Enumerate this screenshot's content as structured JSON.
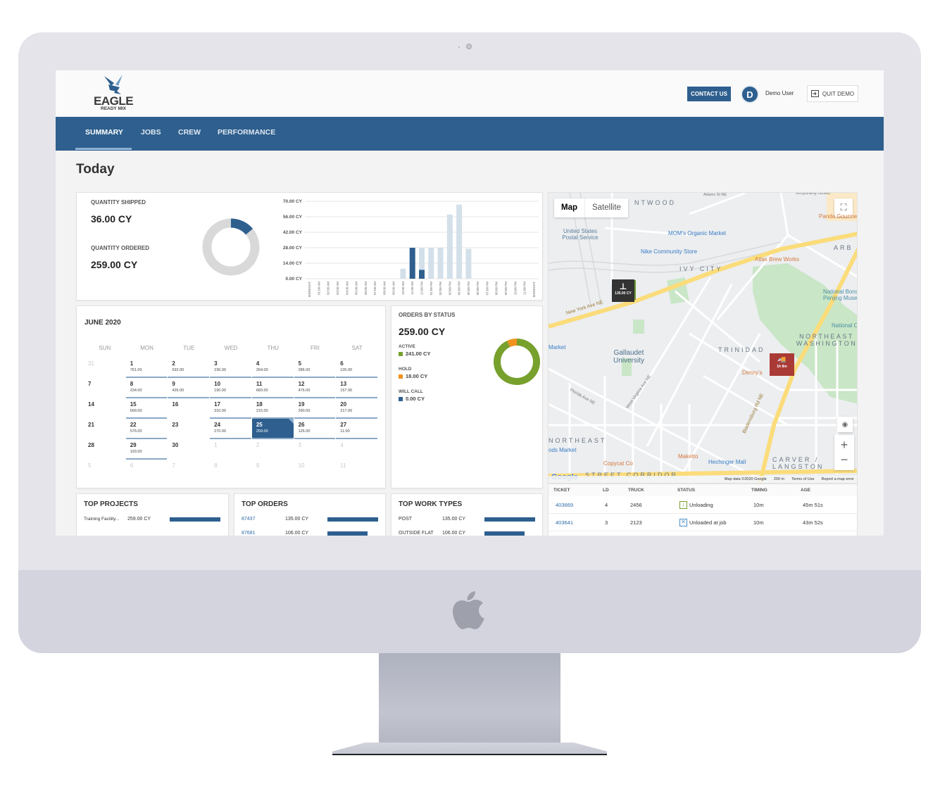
{
  "app": {
    "brand": "EAGLE",
    "brand_sub": "READY MIX",
    "contact_label": "CONTACT US",
    "user_initial": "D",
    "user_name": "Demo User",
    "quit_label": "QUIT DEMO"
  },
  "nav": {
    "items": [
      {
        "label": "SUMMARY",
        "active": true
      },
      {
        "label": "JOBS",
        "active": false
      },
      {
        "label": "CREW",
        "active": false
      },
      {
        "label": "PERFORMANCE",
        "active": false
      }
    ]
  },
  "page_title": "Today",
  "quantity": {
    "shipped_label": "QUANTITY SHIPPED",
    "shipped_value": "36.00 CY",
    "ordered_label": "QUANTITY ORDERED",
    "ordered_value": "259.00 CY",
    "shipped_fraction": 0.139
  },
  "chart_data": {
    "type": "bar",
    "title": "",
    "xlabel": "",
    "ylabel": "",
    "ylim": [
      0,
      70
    ],
    "yticks": [
      "0.00 CY",
      "14.00 CY",
      "28.00 CY",
      "42.00 CY",
      "56.00 CY",
      "70.00 CY"
    ],
    "categories": [
      "MIDNIGHT",
      "01:00 AM",
      "02:00 AM",
      "03:00 AM",
      "04:00 AM",
      "05:00 AM",
      "06:00 AM",
      "07:00 AM",
      "08:00 AM",
      "09:00 AM",
      "10:00 AM",
      "11:00 AM",
      "12:00 PM",
      "01:00 PM",
      "02:00 PM",
      "03:00 PM",
      "04:00 PM",
      "05:00 PM",
      "06:00 PM",
      "07:00 PM",
      "08:00 PM",
      "09:00 PM",
      "10:00 PM",
      "11:00 PM",
      "MIDNIGHT"
    ],
    "series": [
      {
        "name": "Ordered",
        "color": "#d3e0ea",
        "values": [
          0,
          0,
          0,
          0,
          0,
          0,
          0,
          0,
          0,
          0,
          9,
          28,
          28,
          28,
          28,
          58,
          67,
          27,
          0,
          0,
          0,
          0,
          0,
          0,
          0
        ]
      },
      {
        "name": "Shipped",
        "color": "#2e5f8e",
        "values": [
          0,
          0,
          0,
          0,
          0,
          0,
          0,
          0,
          0,
          0,
          0,
          28,
          8,
          0,
          0,
          0,
          0,
          0,
          0,
          0,
          0,
          0,
          0,
          0,
          0
        ]
      }
    ],
    "grid": true,
    "legend": "none"
  },
  "calendar": {
    "title": "JUNE 2020",
    "weekdays": [
      "SUN",
      "MON",
      "TUE",
      "WED",
      "THU",
      "FRI",
      "SAT"
    ],
    "weeks": [
      [
        {
          "d": "31",
          "m": true
        },
        {
          "d": "1",
          "v": "761.00"
        },
        {
          "d": "2",
          "v": "592.00"
        },
        {
          "d": "3",
          "v": "236.00"
        },
        {
          "d": "4",
          "v": "264.00"
        },
        {
          "d": "5",
          "v": "286.00"
        },
        {
          "d": "6",
          "v": "105.00"
        }
      ],
      [
        {
          "d": "7"
        },
        {
          "d": "8",
          "v": "234.00"
        },
        {
          "d": "9",
          "v": "426.00"
        },
        {
          "d": "10",
          "v": "190.00"
        },
        {
          "d": "11",
          "v": "683.00"
        },
        {
          "d": "12",
          "v": "476.00"
        },
        {
          "d": "13",
          "v": "157.00"
        }
      ],
      [
        {
          "d": "14"
        },
        {
          "d": "15",
          "v": "699.00"
        },
        {
          "d": "16"
        },
        {
          "d": "17",
          "v": "310.00"
        },
        {
          "d": "18",
          "v": "215.00"
        },
        {
          "d": "19",
          "v": "290.00"
        },
        {
          "d": "20",
          "v": "217.00"
        }
      ],
      [
        {
          "d": "21"
        },
        {
          "d": "22",
          "v": "576.00"
        },
        {
          "d": "23"
        },
        {
          "d": "24",
          "v": "270.00"
        },
        {
          "d": "25",
          "v": "259.00",
          "s": true
        },
        {
          "d": "26",
          "v": "126.00"
        },
        {
          "d": "27",
          "v": "11.00"
        }
      ],
      [
        {
          "d": "28"
        },
        {
          "d": "29",
          "v": "193.00"
        },
        {
          "d": "30"
        },
        {
          "d": "1",
          "m": true
        },
        {
          "d": "2",
          "m": true
        },
        {
          "d": "3",
          "m": true
        },
        {
          "d": "4",
          "m": true
        }
      ],
      [
        {
          "d": "5",
          "m": true
        },
        {
          "d": "6",
          "m": true
        },
        {
          "d": "7",
          "m": true
        },
        {
          "d": "8",
          "m": true
        },
        {
          "d": "9",
          "m": true
        },
        {
          "d": "10",
          "m": true
        },
        {
          "d": "11",
          "m": true
        }
      ]
    ]
  },
  "orders_by_status": {
    "title": "ORDERS BY STATUS",
    "total": "259.00 CY",
    "items": [
      {
        "label": "ACTIVE",
        "value": "241.00 CY",
        "amount": 241,
        "color": "#77a02d"
      },
      {
        "label": "HOLD",
        "value": "18.00 CY",
        "amount": 18,
        "color": "#f0921e"
      },
      {
        "label": "WILL CALL",
        "value": "0.00 CY",
        "amount": 0,
        "color": "#2e5f8e"
      }
    ]
  },
  "top_projects": {
    "title": "TOP PROJECTS",
    "rows": [
      {
        "name": "Training Facility...",
        "qty": "259.00 CY",
        "fraction": 1.0
      }
    ]
  },
  "top_orders": {
    "title": "TOP ORDERS",
    "rows": [
      {
        "name": "87437",
        "qty": "135.00 CY",
        "fraction": 1.0
      },
      {
        "name": "87681",
        "qty": "106.00 CY",
        "fraction": 0.79
      }
    ]
  },
  "top_work_types": {
    "title": "TOP WORK TYPES",
    "rows": [
      {
        "name": "POST",
        "qty": "135.00 CY",
        "fraction": 1.0
      },
      {
        "name": "OUTSIDE FLAT",
        "qty": "106.00 CY",
        "fraction": 0.79
      }
    ]
  },
  "map": {
    "toggle_map": "Map",
    "toggle_satellite": "Satellite",
    "labels": {
      "brentwood": "NTWOOD",
      "usps": "United States Postal Service",
      "moms": "MOM's Organic Market",
      "nike": "Nike Community Store",
      "atlas": "Atlas Brew Works",
      "ivy": "IVY CITY",
      "panda": "Panda Gourmet",
      "arb": "ARB",
      "bonsai": "National Bonsai Penjing Museum",
      "natcap": "National Cap",
      "ne_wash": "NORTHEAST WASHINGTON",
      "trinidad": "TRINIDAD",
      "dennys": "Denny's",
      "gallaudet": "Gallaudet University",
      "market": "Market",
      "northeast": "NORTHEAST",
      "foods": "ods Market",
      "copycat": "Copycat Co",
      "maketto": "Maketto",
      "hechinger": "Hechinger Mall",
      "carver": "CARVER / LANGSTON",
      "hstreet": "STREET CORRIDOR",
      "ny_ave": "New York Ave NE",
      "bladensburg": "Bladensburg Rd NE",
      "florida": "Florida Ave NE",
      "wva": "West Virginia Ave NE",
      "temp_closed": "Temporarily closed",
      "adams": "Adams St NE"
    },
    "marker_job": "135.00 CY",
    "marker_truck": "1h 8m",
    "footer_data": "Map data ©2020 Google",
    "footer_scale": "200 m",
    "footer_terms": "Terms of Use",
    "footer_report": "Report a map error",
    "google": "Google"
  },
  "tickets": {
    "headers": [
      "TICKET",
      "LD",
      "TRUCK",
      "STATUS",
      "TIMING",
      "AGE"
    ],
    "rows": [
      {
        "ticket": "403669",
        "ld": "4",
        "truck": "2456",
        "status": "Unloading",
        "status_color": "#77a02d",
        "timing": "10m",
        "age": "45m 51s"
      },
      {
        "ticket": "403641",
        "ld": "3",
        "truck": "2123",
        "status": "Unloaded at job",
        "status_color": "#4a8fc7",
        "timing": "10m",
        "age": "43m 52s"
      }
    ]
  }
}
